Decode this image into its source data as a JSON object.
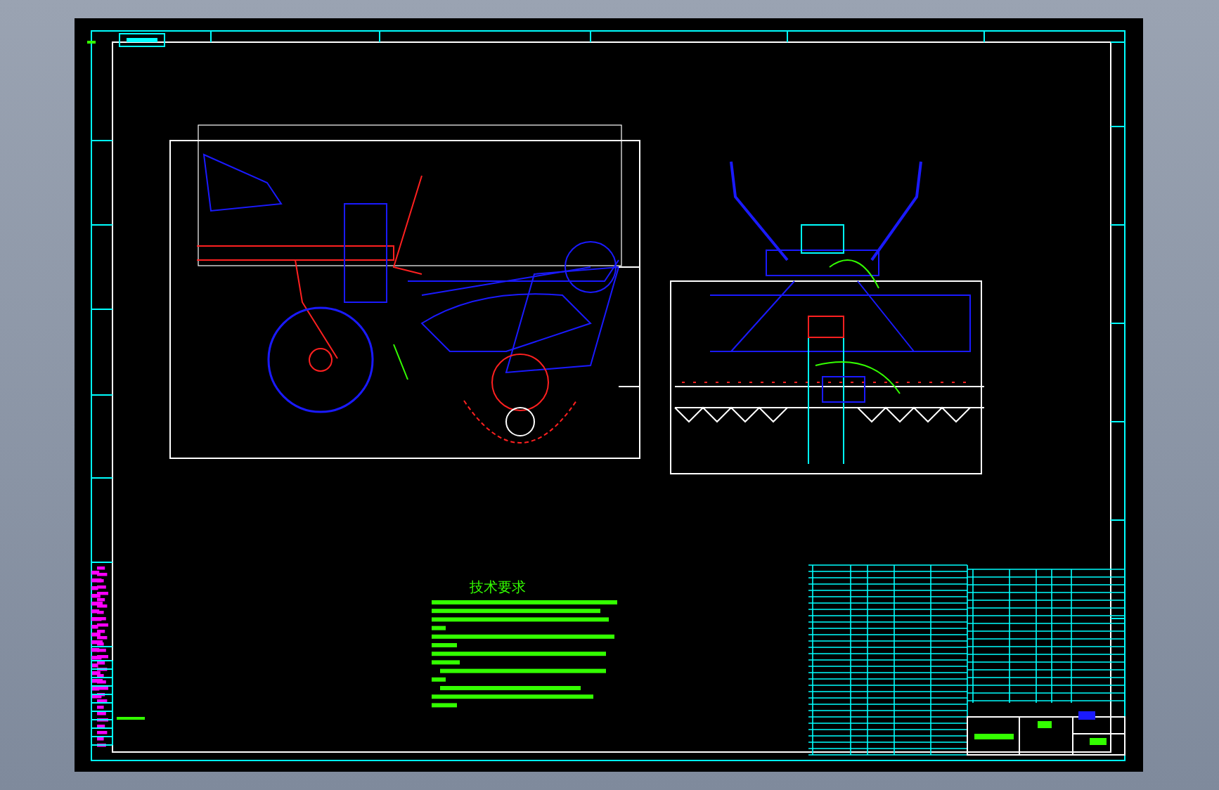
{
  "notes": {
    "heading": "技术要求"
  }
}
